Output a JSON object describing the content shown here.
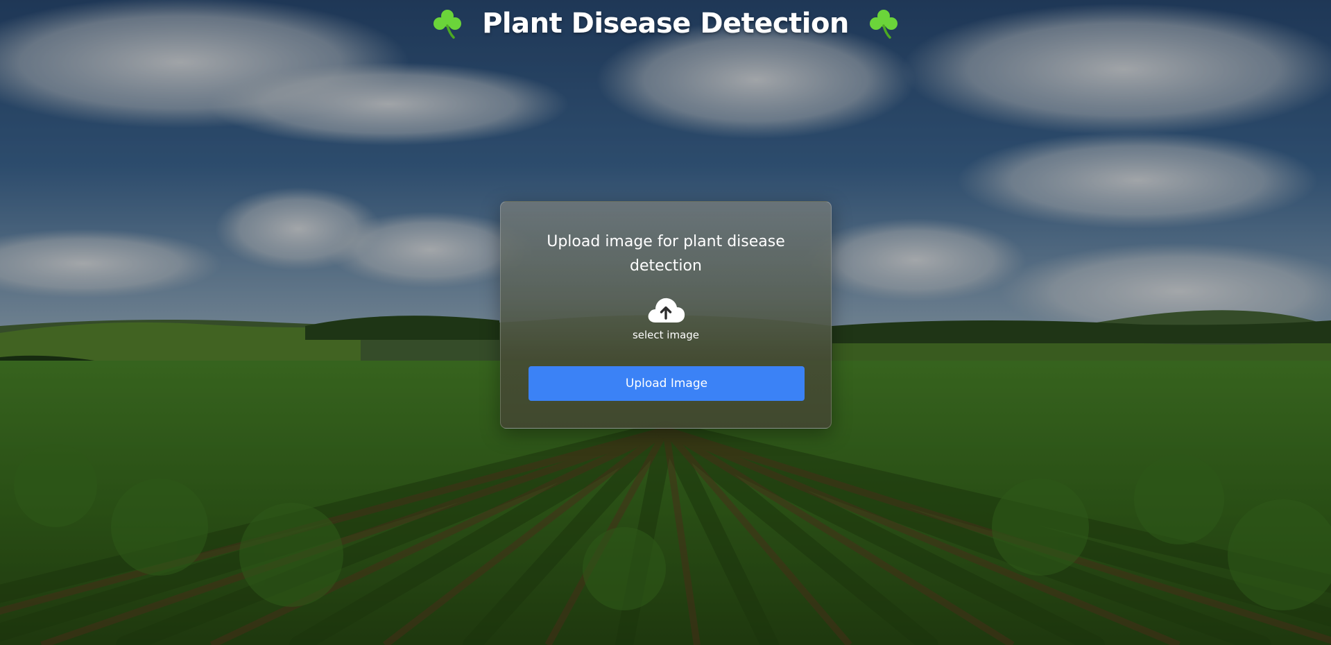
{
  "header": {
    "title": "Plant Disease Detection",
    "left_icon": "shamrock-icon",
    "right_icon": "shamrock-icon",
    "icon_color": "#6bd43a"
  },
  "upload_card": {
    "prompt": "Upload image for plant disease detection",
    "select_icon": "cloud-upload-icon",
    "select_label": "select image",
    "button_label": "Upload Image",
    "button_color": "#3b82f6"
  },
  "background": {
    "scene": "vineyard-landscape",
    "sky_color": "#2f4f7a",
    "field_color": "#3f7a22"
  }
}
